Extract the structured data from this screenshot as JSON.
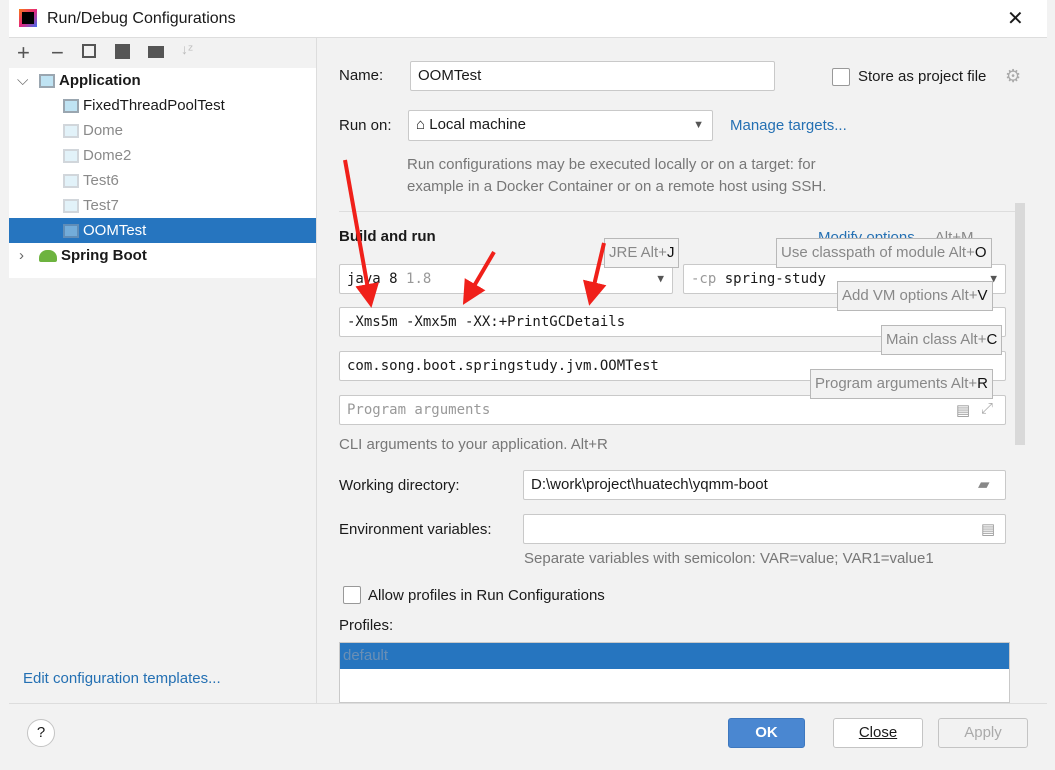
{
  "window": {
    "title": "Run/Debug Configurations"
  },
  "toolbar": {
    "add": "+",
    "remove": "−"
  },
  "tree": {
    "groups": [
      {
        "label": "Application",
        "expanded": true
      },
      {
        "label": "Spring Boot",
        "expanded": false
      }
    ],
    "items": [
      "FixedThreadPoolTest",
      "Dome",
      "Dome2",
      "Test6",
      "Test7",
      "OOMTest"
    ],
    "selected": "OOMTest"
  },
  "left_footer": {
    "templates_link": "Edit configuration templates..."
  },
  "form": {
    "name_label": "Name:",
    "name_value": "OOMTest",
    "store_label": "Store as project file",
    "run_on_label": "Run on:",
    "run_on_value": "Local machine",
    "manage_targets": "Manage targets...",
    "run_on_help": [
      "Run configurations may be executed locally or on a target: for",
      "example in a Docker Container or on a remote host using SSH."
    ],
    "build_run_title": "Build and run",
    "modify_options": "Modify options",
    "modify_shortcut": "Alt+M",
    "jre_value": "java 8",
    "jre_version": "1.8",
    "cp_prefix": "-cp",
    "cp_value": "spring-study",
    "vm_options": "-Xms5m -Xmx5m -XX:+PrintGCDetails",
    "main_class": "com.song.boot.springstudy.jvm.OOMTest",
    "program_args_placeholder": "Program arguments",
    "cli_help": "CLI arguments to your application. Alt+R",
    "workdir_label": "Working directory:",
    "workdir_value": "D:\\work\\project\\huatech\\yqmm-boot",
    "env_label": "Environment variables:",
    "env_value": "",
    "env_help": "Separate variables with semicolon: VAR=value; VAR1=value1",
    "profiles_checkbox": "Allow profiles in Run Configurations",
    "profiles_label": "Profiles:",
    "profiles_items": [
      "default"
    ]
  },
  "hints": {
    "jre": {
      "text": "JRE Alt+",
      "key": "J"
    },
    "classpath": {
      "text": "Use classpath of module Alt+",
      "key": "O"
    },
    "vm": {
      "text": "Add VM options Alt+",
      "key": "V"
    },
    "main": {
      "text": "Main class Alt+",
      "key": "C"
    },
    "args": {
      "text": "Program arguments Alt+",
      "key": "R"
    }
  },
  "footer": {
    "help": "?",
    "ok": "OK",
    "close": "Close",
    "apply": "Apply"
  },
  "colors": {
    "selection": "#2675bf",
    "link": "#2470b3",
    "annotation_arrow": "#f0201a"
  }
}
